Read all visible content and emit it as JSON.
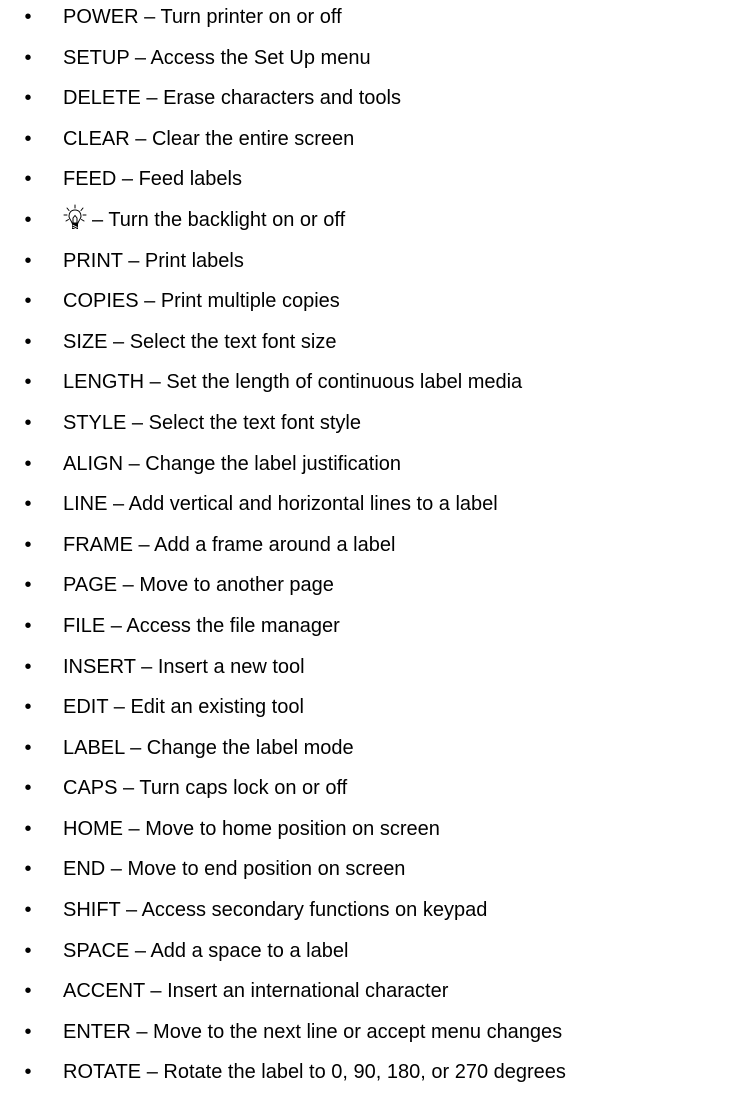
{
  "items": [
    {
      "key": "POWER",
      "sep": " – ",
      "desc": "Turn printer on or off"
    },
    {
      "key": "SETUP",
      "sep": " – ",
      "desc": "Access the Set Up menu"
    },
    {
      "key": "DELETE",
      "sep": " – ",
      "desc": "Erase characters and tools"
    },
    {
      "key": "CLEAR",
      "sep": " – ",
      "desc": "Clear the entire screen"
    },
    {
      "key": "FEED",
      "sep": " – ",
      "desc": "Feed labels"
    },
    {
      "key": "",
      "icon": "lightbulb-icon",
      "sep": "–  ",
      "desc": "Turn the backlight on or off"
    },
    {
      "key": "PRINT",
      "sep": " – ",
      "desc": "Print labels"
    },
    {
      "key": "COPIES",
      "sep": " – ",
      "desc": "Print multiple copies"
    },
    {
      "key": "SIZE",
      "sep": " – ",
      "desc": "Select the text font size"
    },
    {
      "key": "LENGTH",
      "sep": " – ",
      "desc": "Set the length of continuous label media"
    },
    {
      "key": "STYLE",
      "sep": " – ",
      "desc": "Select the text font style"
    },
    {
      "key": "ALIGN",
      "sep": " – ",
      "desc": "Change the label justification"
    },
    {
      "key": "LINE",
      "sep": " – ",
      "desc": "Add vertical and horizontal lines to a label"
    },
    {
      "key": "FRAME",
      "sep": " – ",
      "desc": "Add a frame around a label"
    },
    {
      "key": "PAGE",
      "sep": " – ",
      "desc": "Move to another page"
    },
    {
      "key": "FILE",
      "sep": " – ",
      "desc": "Access the file manager"
    },
    {
      "key": "INSERT",
      "sep": " – ",
      "desc": "Insert a new tool"
    },
    {
      "key": "EDIT",
      "sep": " – ",
      "desc": "Edit an existing tool"
    },
    {
      "key": "LABEL",
      "sep": " – ",
      "desc": "Change the label mode"
    },
    {
      "key": "CAPS",
      "sep": " – ",
      "desc": "Turn caps lock on or off"
    },
    {
      "key": "HOME",
      "sep": " – ",
      "desc": "Move to home position on screen"
    },
    {
      "key": "END",
      "sep": " – ",
      "desc": "Move to end position on screen"
    },
    {
      "key": "SHIFT",
      "sep": " – ",
      "desc": "Access secondary functions on keypad"
    },
    {
      "key": "SPACE",
      "sep": " – ",
      "desc": "Add a space to a label"
    },
    {
      "key": "ACCENT",
      "sep": " – ",
      "desc": "Insert an international character"
    },
    {
      "key": "ENTER",
      "sep": " – ",
      "desc": "Move to the next line or accept menu changes"
    },
    {
      "key": "ROTATE",
      "sep": " – ",
      "desc": "Rotate the label to 0, 90, 180, or 270 degrees"
    }
  ]
}
